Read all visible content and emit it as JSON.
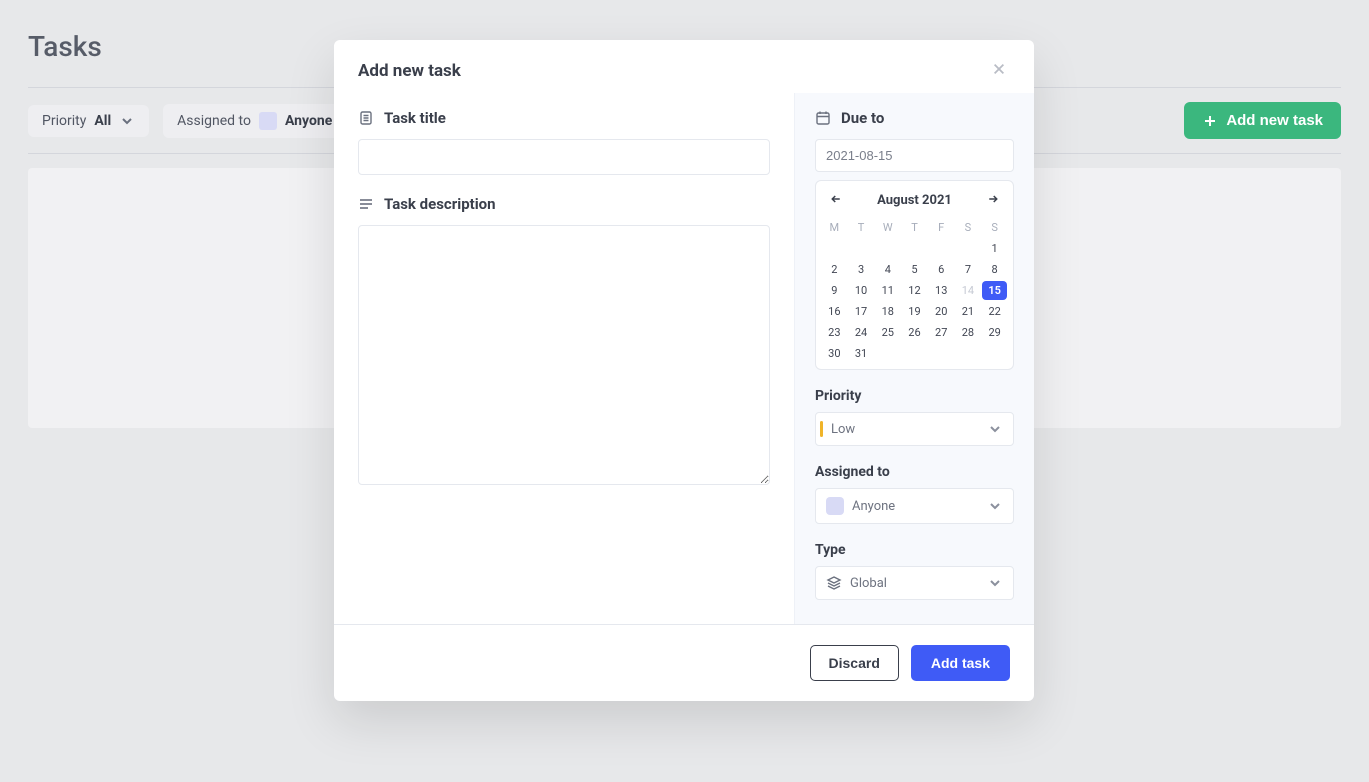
{
  "page": {
    "title": "Tasks",
    "filters": {
      "priority_label": "Priority",
      "priority_value": "All",
      "assigned_label": "Assigned to",
      "assigned_value": "Anyone"
    },
    "add_button": "Add new task"
  },
  "modal": {
    "title": "Add new task",
    "left": {
      "title_label": "Task title",
      "title_value": "",
      "description_label": "Task description",
      "description_value": ""
    },
    "right": {
      "due_label": "Due to",
      "due_value": "2021-08-15",
      "calendar": {
        "month_label": "August 2021",
        "dow": [
          "M",
          "T",
          "W",
          "T",
          "F",
          "S",
          "S"
        ],
        "weeks": [
          [
            null,
            null,
            null,
            null,
            null,
            null,
            1
          ],
          [
            2,
            3,
            4,
            5,
            6,
            7,
            8
          ],
          [
            9,
            10,
            11,
            12,
            13,
            14,
            15
          ],
          [
            16,
            17,
            18,
            19,
            20,
            21,
            22
          ],
          [
            23,
            24,
            25,
            26,
            27,
            28,
            29
          ],
          [
            30,
            31,
            null,
            null,
            null,
            null,
            null
          ]
        ],
        "selected": 15,
        "dim": [
          14
        ]
      },
      "priority_label": "Priority",
      "priority_value": "Low",
      "assigned_label": "Assigned to",
      "assigned_value": "Anyone",
      "type_label": "Type",
      "type_value": "Global"
    },
    "footer": {
      "discard": "Discard",
      "add": "Add task"
    }
  }
}
